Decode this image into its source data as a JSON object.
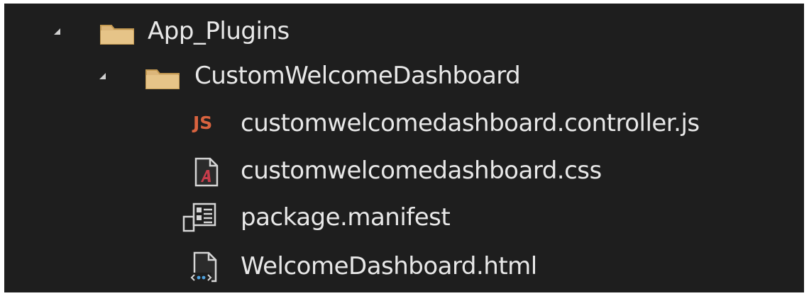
{
  "tree": {
    "items": [
      {
        "label": "App_Plugins",
        "icon": "folder-icon",
        "expanded": true,
        "level": 0
      },
      {
        "label": "CustomWelcomeDashboard",
        "icon": "folder-icon",
        "expanded": true,
        "level": 1
      },
      {
        "label": "customwelcomedashboard.controller.js",
        "icon": "javascript-file-icon",
        "icon_text": "JS",
        "level": 2
      },
      {
        "label": "customwelcomedashboard.css",
        "icon": "css-file-icon",
        "level": 2
      },
      {
        "label": "package.manifest",
        "icon": "manifest-file-icon",
        "level": 2
      },
      {
        "label": "WelcomeDashboard.html",
        "icon": "html-file-icon",
        "level": 2
      }
    ]
  },
  "colors": {
    "background": "#1e1e1e",
    "text": "#e8e8e8",
    "folder_fill": "#dcb67a",
    "js_accent": "#d9633f",
    "css_accent": "#c83c4b",
    "html_accent": "#4fa3e0"
  }
}
